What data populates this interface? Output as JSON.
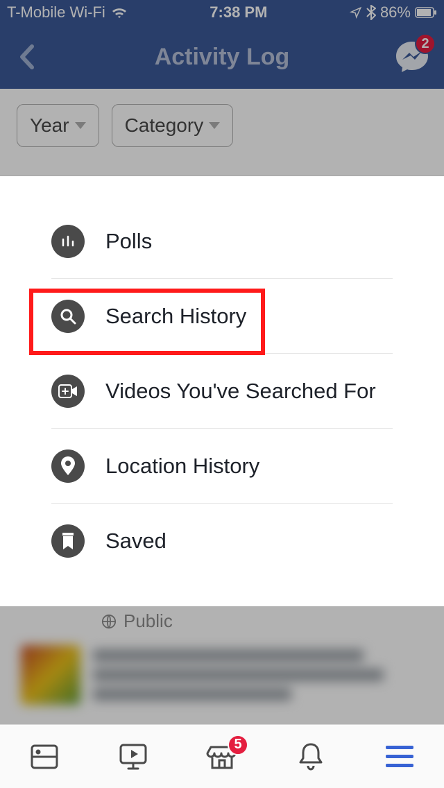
{
  "status": {
    "carrier": "T-Mobile Wi-Fi",
    "time": "7:38 PM",
    "battery": "86%"
  },
  "header": {
    "title": "Activity Log",
    "messenger_badge": "2"
  },
  "filters": {
    "year": "Year",
    "category": "Category"
  },
  "sheet": {
    "items": [
      {
        "label": "Polls"
      },
      {
        "label": "Search History"
      },
      {
        "label": "Videos You've Searched For"
      },
      {
        "label": "Location History"
      },
      {
        "label": "Saved"
      }
    ]
  },
  "below": {
    "visibility": "Public"
  },
  "tabbar": {
    "marketplace_badge": "5"
  },
  "highlight": {
    "target_index": 1
  }
}
